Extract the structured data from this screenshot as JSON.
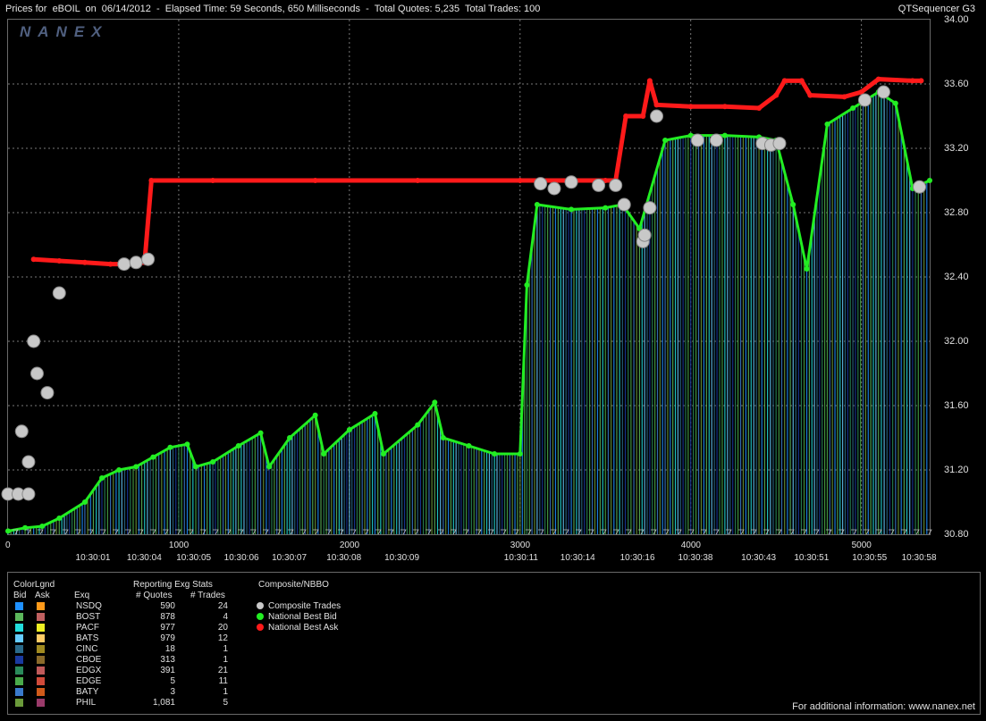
{
  "header": {
    "title": "Prices for  eBOIL  on  06/14/2012  -  Elapsed Time: 59 Seconds, 650 Milliseconds  -  Total Quotes: 5,235  Total Trades: 100",
    "app_name": "QTSequencer G3"
  },
  "watermark": "NANEX",
  "chart_data": {
    "type": "line",
    "title": "Prices for eBOIL on 06/14/2012",
    "ylim": [
      30.8,
      34.0
    ],
    "xlim": [
      0,
      5400
    ],
    "y_ticks": [
      "34.00",
      "33.60",
      "33.20",
      "32.80",
      "32.40",
      "32.00",
      "31.60",
      "31.20",
      "30.80"
    ],
    "x_tick_numbers": [
      "0",
      "1000",
      "2000",
      "3000",
      "4000",
      "5000"
    ],
    "x_tick_times": [
      {
        "x": 490,
        "label": "10:30:01"
      },
      {
        "x": 790,
        "label": "10:30:04"
      },
      {
        "x": 1080,
        "label": "10:30:05"
      },
      {
        "x": 1360,
        "label": "10:30:06"
      },
      {
        "x": 1640,
        "label": "10:30:07"
      },
      {
        "x": 1960,
        "label": "10:30:08"
      },
      {
        "x": 2300,
        "label": "10:30:09"
      },
      {
        "x": 3000,
        "label": "10:30:11"
      },
      {
        "x": 3330,
        "label": "10:30:14"
      },
      {
        "x": 3680,
        "label": "10:30:16"
      },
      {
        "x": 4020,
        "label": "10:30:38"
      },
      {
        "x": 4390,
        "label": "10:30:43"
      },
      {
        "x": 4700,
        "label": "10:30:51"
      },
      {
        "x": 5040,
        "label": "10:30:55"
      },
      {
        "x": 5330,
        "label": "10:30:58"
      }
    ],
    "grid": true,
    "series": [
      {
        "name": "National Best Ask",
        "color": "#ff1a1a",
        "points": [
          [
            150,
            32.51
          ],
          [
            300,
            32.5
          ],
          [
            450,
            32.49
          ],
          [
            600,
            32.48
          ],
          [
            700,
            32.48
          ],
          [
            800,
            32.49
          ],
          [
            840,
            33.0
          ],
          [
            1200,
            33.0
          ],
          [
            1800,
            33.0
          ],
          [
            2400,
            33.0
          ],
          [
            3000,
            33.0
          ],
          [
            3300,
            33.0
          ],
          [
            3500,
            33.0
          ],
          [
            3560,
            33.0
          ],
          [
            3620,
            33.4
          ],
          [
            3720,
            33.4
          ],
          [
            3760,
            33.62
          ],
          [
            3800,
            33.47
          ],
          [
            4000,
            33.46
          ],
          [
            4200,
            33.46
          ],
          [
            4400,
            33.45
          ],
          [
            4500,
            33.53
          ],
          [
            4550,
            33.62
          ],
          [
            4650,
            33.62
          ],
          [
            4700,
            33.53
          ],
          [
            4900,
            33.52
          ],
          [
            5000,
            33.55
          ],
          [
            5100,
            33.63
          ],
          [
            5300,
            33.62
          ],
          [
            5350,
            33.62
          ]
        ]
      },
      {
        "name": "National Best Bid",
        "color": "#22ee22",
        "points": [
          [
            0,
            30.82
          ],
          [
            100,
            30.84
          ],
          [
            200,
            30.85
          ],
          [
            300,
            30.9
          ],
          [
            450,
            31.0
          ],
          [
            550,
            31.15
          ],
          [
            650,
            31.2
          ],
          [
            750,
            31.22
          ],
          [
            850,
            31.28
          ],
          [
            950,
            31.34
          ],
          [
            1050,
            31.36
          ],
          [
            1100,
            31.22
          ],
          [
            1200,
            31.25
          ],
          [
            1350,
            31.35
          ],
          [
            1480,
            31.43
          ],
          [
            1530,
            31.22
          ],
          [
            1650,
            31.4
          ],
          [
            1800,
            31.54
          ],
          [
            1850,
            31.3
          ],
          [
            2000,
            31.45
          ],
          [
            2150,
            31.55
          ],
          [
            2200,
            31.3
          ],
          [
            2400,
            31.48
          ],
          [
            2500,
            31.62
          ],
          [
            2550,
            31.4
          ],
          [
            2700,
            31.35
          ],
          [
            2850,
            31.3
          ],
          [
            3000,
            31.3
          ],
          [
            3040,
            32.35
          ],
          [
            3100,
            32.85
          ],
          [
            3300,
            32.82
          ],
          [
            3500,
            32.83
          ],
          [
            3600,
            32.85
          ],
          [
            3700,
            32.7
          ],
          [
            3850,
            33.25
          ],
          [
            4000,
            33.28
          ],
          [
            4200,
            33.28
          ],
          [
            4400,
            33.27
          ],
          [
            4500,
            33.25
          ],
          [
            4600,
            32.85
          ],
          [
            4680,
            32.45
          ],
          [
            4800,
            33.35
          ],
          [
            4950,
            33.45
          ],
          [
            5100,
            33.55
          ],
          [
            5200,
            33.48
          ],
          [
            5300,
            32.95
          ],
          [
            5400,
            33.0
          ]
        ]
      }
    ],
    "composite_trades": [
      [
        0,
        31.05
      ],
      [
        60,
        31.05
      ],
      [
        120,
        31.05
      ],
      [
        80,
        31.44
      ],
      [
        120,
        31.25
      ],
      [
        150,
        32.0
      ],
      [
        170,
        31.8
      ],
      [
        230,
        31.68
      ],
      [
        300,
        32.3
      ],
      [
        680,
        32.48
      ],
      [
        750,
        32.49
      ],
      [
        820,
        32.51
      ],
      [
        3120,
        32.98
      ],
      [
        3200,
        32.95
      ],
      [
        3300,
        32.99
      ],
      [
        3460,
        32.97
      ],
      [
        3560,
        32.97
      ],
      [
        3610,
        32.85
      ],
      [
        3720,
        32.62
      ],
      [
        3730,
        32.66
      ],
      [
        3760,
        32.83
      ],
      [
        3800,
        33.4
      ],
      [
        4040,
        33.25
      ],
      [
        4150,
        33.25
      ],
      [
        4420,
        33.23
      ],
      [
        4470,
        33.22
      ],
      [
        4520,
        33.23
      ],
      [
        5020,
        33.5
      ],
      [
        5130,
        33.55
      ],
      [
        5340,
        32.96
      ]
    ]
  },
  "legend": {
    "color_legend_title": "ColorLgnd",
    "bid_header": "Bid",
    "ask_header": "Ask",
    "exchange_header": "Exq",
    "stats_title": "Reporting Exg Stats",
    "quotes_header": "# Quotes",
    "trades_header": "# Trades",
    "composite_title": "Composite/NBBO",
    "exchanges": [
      {
        "name": "NSDQ",
        "quotes": "590",
        "trades": "24",
        "bid_color": "#1e90ff",
        "ask_color": "#ff9a1a"
      },
      {
        "name": "BOST",
        "quotes": "878",
        "trades": "4",
        "bid_color": "#5cb85c",
        "ask_color": "#c06060"
      },
      {
        "name": "PACF",
        "quotes": "977",
        "trades": "20",
        "bid_color": "#22dddd",
        "ask_color": "#eeee22"
      },
      {
        "name": "BATS",
        "quotes": "979",
        "trades": "12",
        "bid_color": "#66ccff",
        "ask_color": "#ffcc66"
      },
      {
        "name": "CINC",
        "quotes": "18",
        "trades": "1",
        "bid_color": "#2a6a8a",
        "ask_color": "#a08a20"
      },
      {
        "name": "CBOE",
        "quotes": "313",
        "trades": "1",
        "bid_color": "#1a3aa0",
        "ask_color": "#8a6a2a"
      },
      {
        "name": "EDGX",
        "quotes": "391",
        "trades": "21",
        "bid_color": "#2a8a5a",
        "ask_color": "#c05a5a"
      },
      {
        "name": "EDGE",
        "quotes": "5",
        "trades": "11",
        "bid_color": "#4aaa4a",
        "ask_color": "#d04a3a"
      },
      {
        "name": "BATY",
        "quotes": "3",
        "trades": "1",
        "bid_color": "#3a7acc",
        "ask_color": "#d05a1a"
      },
      {
        "name": "PHIL",
        "quotes": "1,081",
        "trades": "5",
        "bid_color": "#6a9a3a",
        "ask_color": "#9a3a6a"
      }
    ],
    "composite_items": [
      {
        "label": "Composite Trades",
        "color": "#c8c8c8"
      },
      {
        "label": "National Best Bid",
        "color": "#22ee22"
      },
      {
        "label": "National Best Ask",
        "color": "#ff1a1a"
      }
    ]
  },
  "footer_note": "For additional information: www.nanex.net"
}
